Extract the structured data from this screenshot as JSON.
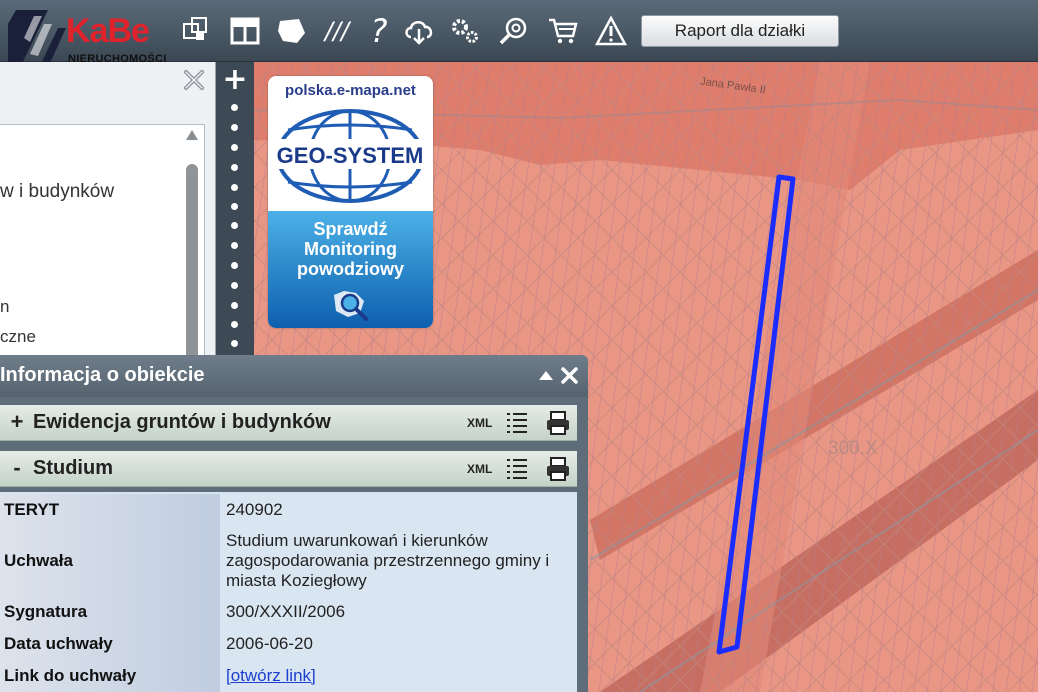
{
  "toolbar": {
    "logo_brand": "KaBe",
    "logo_sub": "NIERUCHOMOŚCI",
    "icons": [
      "layers-icon",
      "layout-icon",
      "shape-icon",
      "hatch-icon",
      "help-icon",
      "cloud-download-icon",
      "settings-icon",
      "search-zoom-icon",
      "cart-icon",
      "warning-icon"
    ],
    "help_glyph": "?",
    "hatch_glyph": "///",
    "raport_label": "Raport dla działki"
  },
  "left_panel": {
    "layers_partial": [
      "w i budynków",
      "n",
      "czne"
    ]
  },
  "zoom": {
    "plus": "+"
  },
  "banner": {
    "site": "polska.e-mapa.net",
    "brand": "GEO-SYSTEM",
    "lines": [
      "Sprawdź",
      "Monitoring",
      "powodziowy"
    ]
  },
  "map": {
    "label_300": "300.X",
    "street": "Jana Pawła II"
  },
  "info_panel": {
    "title": "Informacja o obiekcie",
    "sections": [
      {
        "sign": "+",
        "label": "Ewidencja gruntów i budynków",
        "xml": "XML"
      },
      {
        "sign": "-",
        "label": "Studium",
        "xml": "XML"
      }
    ],
    "rows": [
      {
        "label": "TERYT",
        "value": "240902"
      },
      {
        "label": "Uchwała",
        "value": "Studium uwarunkowań i kierunków zagospodarowania przestrzennego gminy i miasta Koziegłowy"
      },
      {
        "label": "Sygnatura",
        "value": "300/XXXII/2006"
      },
      {
        "label": "Data uchwały",
        "value": "2006-06-20"
      },
      {
        "label": "Link do uchwały",
        "value": "[otwórz link]"
      }
    ]
  },
  "colors": {
    "map_zone": "#e8897a",
    "parcel_outline": "#1a2cff",
    "toolbar": "#4a5865",
    "link": "#1a3fd0"
  }
}
